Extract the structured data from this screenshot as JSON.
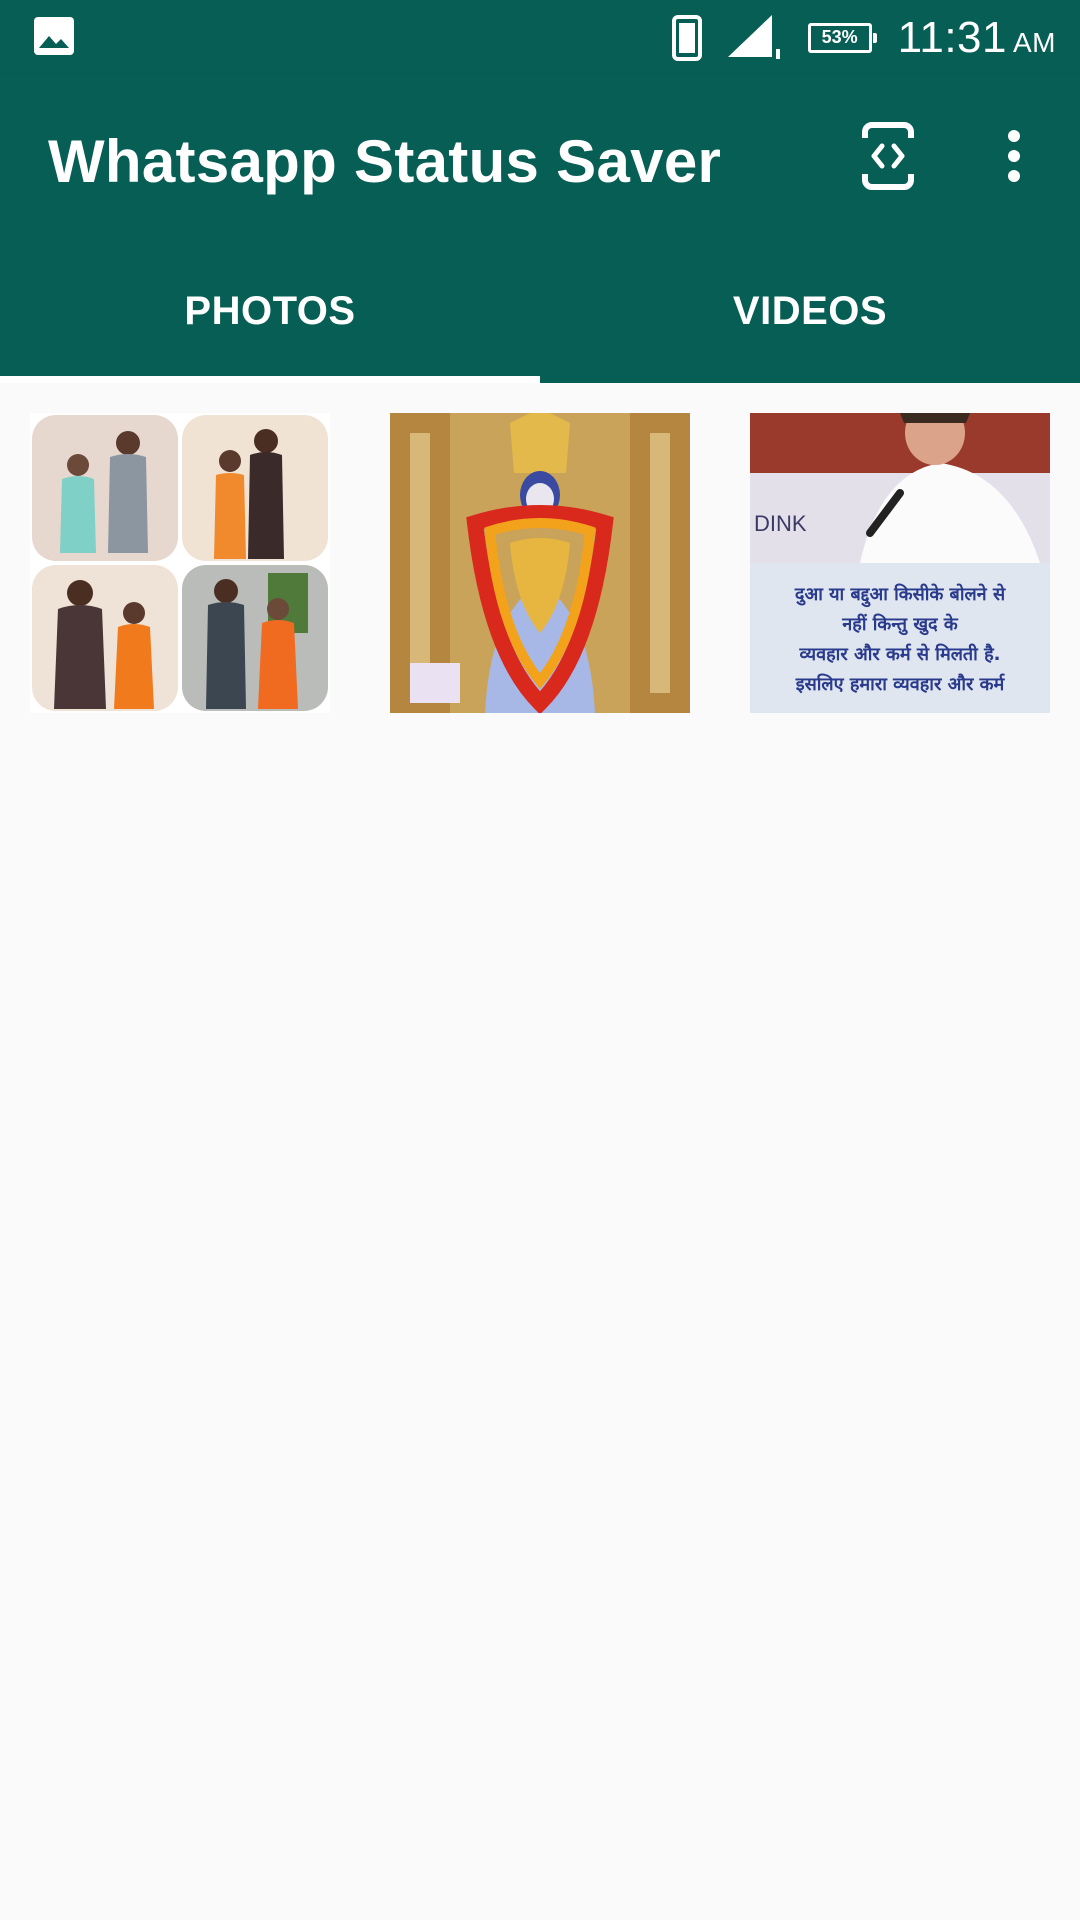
{
  "status_bar": {
    "time": "11:31",
    "am_pm": "AM",
    "battery": "53%",
    "icons": [
      "gallery-icon",
      "phone-icon",
      "signal-icon",
      "battery-icon"
    ]
  },
  "app_bar": {
    "title": "Whatsapp Status Saver",
    "icons": [
      "scan-icon",
      "more-options-icon"
    ]
  },
  "tabs": [
    {
      "label": "PHOTOS",
      "selected": true
    },
    {
      "label": "VIDEOS",
      "selected": false
    }
  ],
  "photos": [
    {
      "id": "couple-collage"
    },
    {
      "id": "deity-idol"
    },
    {
      "id": "speaker-quote",
      "caption_lines": [
        "दुआ या बद्दुआ किसीके बोलने से",
        "नहीं किन्तु खुद के",
        "व्यवहार और कर्म से मिलती है.",
        "इसलिए हमारा व्यवहार और कर्म"
      ]
    }
  ],
  "colors": {
    "primary": "#075e54",
    "background": "#fafafa",
    "indicator": "#ffffff"
  }
}
